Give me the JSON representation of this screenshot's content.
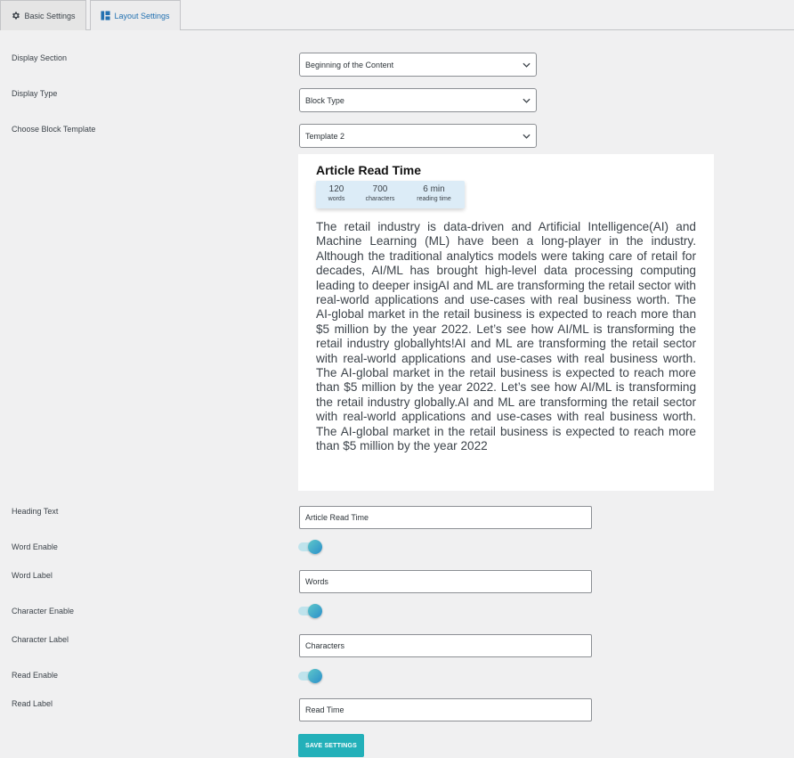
{
  "tabs": {
    "basic": {
      "label": "Basic Settings",
      "icon": "gear-icon"
    },
    "layout": {
      "label": "Layout Settings",
      "icon": "layout-icon",
      "active": true
    }
  },
  "display_section": {
    "label": "Display Section",
    "value": "Beginning of the Content"
  },
  "display_type": {
    "label": "Display Type",
    "value": "Block Type"
  },
  "block_template": {
    "label": "Choose Block Template",
    "value": "Template 2"
  },
  "preview": {
    "title": "Article Read Time",
    "stats": [
      {
        "num": "120",
        "caption": "words"
      },
      {
        "num": "700",
        "caption": "characters"
      },
      {
        "num": "6 min",
        "caption": "reading time"
      }
    ],
    "text": "The retail industry is data-driven and Artificial Intelligence(AI) and Machine Learning (ML) have been a long-player in the industry. Although the traditional analytics models were taking care of retail for decades, AI/ML has brought high-level data processing computing leading to deeper insigAI and ML are transforming the retail sector with real-world applications and use-cases with real business worth. The AI-global market in the retail business is expected to reach more than $5 million by the year 2022. Let’s see how AI/ML is transforming the retail industry globallyhts!AI and ML are transforming the retail sector with real-world applications and use-cases with real business worth. The AI-global market in the retail business is expected to reach more than $5 million by the year 2022. Let’s see how AI/ML is transforming the retail industry globally.AI and ML are transforming the retail sector with real-world applications and use-cases with real business worth. The AI-global market in the retail business is expected to reach more than $5 million by the year 2022"
  },
  "heading_text": {
    "label": "Heading Text",
    "value": "Article Read Time"
  },
  "word_enable": {
    "label": "Word Enable",
    "on": true
  },
  "word_label": {
    "label": "Word Label",
    "value": "Words"
  },
  "character_enable": {
    "label": "Character Enable",
    "on": true
  },
  "character_label": {
    "label": "Character Label",
    "value": "Characters"
  },
  "read_enable": {
    "label": "Read Enable",
    "on": true
  },
  "read_label": {
    "label": "Read Label",
    "value": "Read Time"
  },
  "save_button": {
    "label": "SAVE SETTINGS"
  },
  "colors": {
    "accent": "#23b0b9",
    "tab_active_text": "#2271b1",
    "toggle_on": "#2b8fcb"
  }
}
